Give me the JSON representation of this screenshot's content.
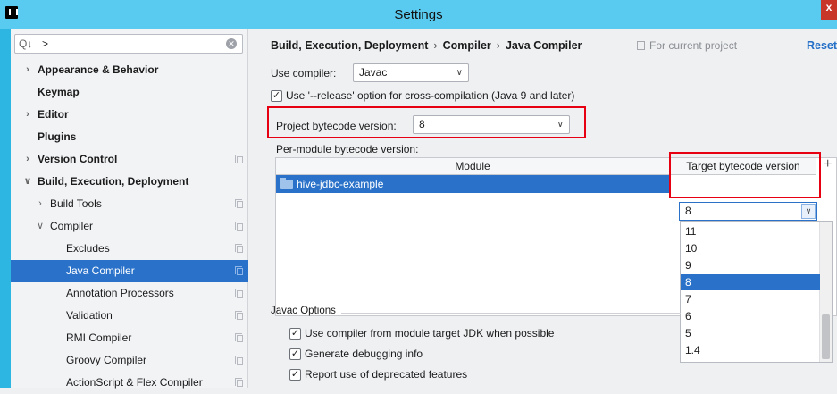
{
  "window": {
    "title": "Settings",
    "close_label": "x"
  },
  "search": {
    "icon": "Q↓",
    "value": ">"
  },
  "tree": [
    {
      "label": "Appearance & Behavior",
      "arrow": "›",
      "level": 0,
      "bold": true,
      "selected": false,
      "copy": false
    },
    {
      "label": "Keymap",
      "arrow": "",
      "level": 0,
      "bold": true,
      "selected": false,
      "copy": false
    },
    {
      "label": "Editor",
      "arrow": "›",
      "level": 0,
      "bold": true,
      "selected": false,
      "copy": false
    },
    {
      "label": "Plugins",
      "arrow": "",
      "level": 0,
      "bold": true,
      "selected": false,
      "copy": false
    },
    {
      "label": "Version Control",
      "arrow": "›",
      "level": 0,
      "bold": true,
      "selected": false,
      "copy": true
    },
    {
      "label": "Build, Execution, Deployment",
      "arrow": "∨",
      "level": 0,
      "bold": true,
      "selected": false,
      "copy": false
    },
    {
      "label": "Build Tools",
      "arrow": "›",
      "level": 1,
      "bold": false,
      "selected": false,
      "copy": true
    },
    {
      "label": "Compiler",
      "arrow": "∨",
      "level": 1,
      "bold": false,
      "selected": false,
      "copy": true
    },
    {
      "label": "Excludes",
      "arrow": "",
      "level": 2,
      "bold": false,
      "selected": false,
      "copy": true
    },
    {
      "label": "Java Compiler",
      "arrow": "",
      "level": 2,
      "bold": false,
      "selected": true,
      "copy": true
    },
    {
      "label": "Annotation Processors",
      "arrow": "",
      "level": 2,
      "bold": false,
      "selected": false,
      "copy": true
    },
    {
      "label": "Validation",
      "arrow": "",
      "level": 2,
      "bold": false,
      "selected": false,
      "copy": true
    },
    {
      "label": "RMI Compiler",
      "arrow": "",
      "level": 2,
      "bold": false,
      "selected": false,
      "copy": true
    },
    {
      "label": "Groovy Compiler",
      "arrow": "",
      "level": 2,
      "bold": false,
      "selected": false,
      "copy": true
    },
    {
      "label": "ActionScript & Flex Compiler",
      "arrow": "",
      "level": 2,
      "bold": false,
      "selected": false,
      "copy": true
    }
  ],
  "breadcrumb": {
    "part1": "Build, Execution, Deployment",
    "part2": "Compiler",
    "part3": "Java Compiler",
    "separator": "›"
  },
  "scope_label": "For current project",
  "reset_label": "Reset",
  "use_compiler": {
    "label": "Use compiler:",
    "value": "Javac"
  },
  "release_option": {
    "label": "Use '--release' option for cross-compilation (Java 9 and later)",
    "checked": true
  },
  "project_bytecode": {
    "label": "Project bytecode version:",
    "value": "8"
  },
  "per_module_label": "Per-module bytecode version:",
  "module_table": {
    "col_module": "Module",
    "col_target": "Target bytecode version",
    "add_label": "+",
    "rows": [
      {
        "module": "hive-jdbc-example",
        "target": "8"
      }
    ]
  },
  "target_dropdown": {
    "options": [
      "11",
      "10",
      "9",
      "8",
      "7",
      "6",
      "5",
      "1.4"
    ],
    "selected": "8"
  },
  "javac_options": {
    "title": "Javac Options",
    "items": [
      {
        "label": "Use compiler from module target JDK when possible",
        "checked": true
      },
      {
        "label": "Generate debugging info",
        "checked": true
      },
      {
        "label": "Report use of deprecated features",
        "checked": true
      }
    ]
  },
  "colors": {
    "accent": "#2a72c9",
    "highlight_box": "#e60012",
    "titlebar": "#5acbf0"
  }
}
